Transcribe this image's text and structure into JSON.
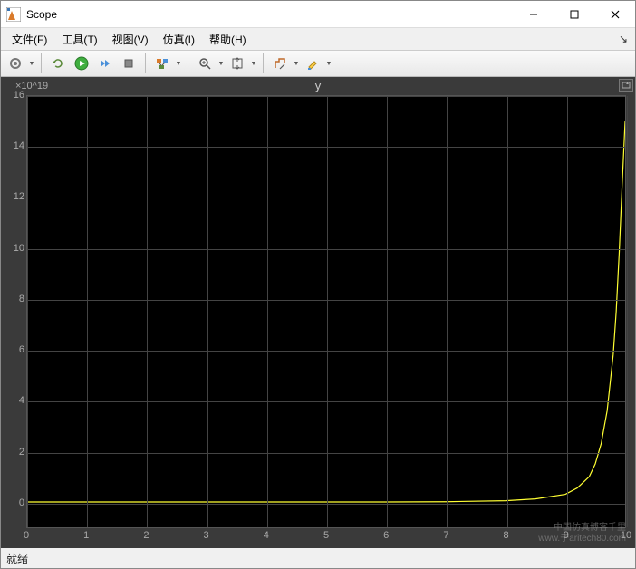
{
  "window": {
    "title": "Scope"
  },
  "menu": {
    "file": "文件(F)",
    "tools": "工具(T)",
    "view": "视图(V)",
    "simulation": "仿真(I)",
    "help": "帮助(H)"
  },
  "status": {
    "text": "就绪"
  },
  "watermark": {
    "line1": "中国仿真博客千里",
    "line2": "www.于aritech80.com"
  },
  "chart_data": {
    "type": "line",
    "title": "y",
    "xlabel": "",
    "ylabel": "",
    "exponent_label": "×10^19",
    "xlim": [
      0,
      10
    ],
    "ylim": [
      -1,
      16
    ],
    "x_ticks": [
      0,
      1,
      2,
      3,
      4,
      5,
      6,
      7,
      8,
      9,
      10
    ],
    "y_ticks": [
      0,
      2,
      4,
      6,
      8,
      10,
      12,
      14,
      16
    ],
    "grid": true,
    "series": [
      {
        "name": "y",
        "color": "#ffff33",
        "x": [
          0,
          1,
          2,
          3,
          4,
          5,
          6,
          7,
          8,
          8.5,
          9,
          9.2,
          9.4,
          9.5,
          9.6,
          9.7,
          9.8,
          9.85,
          9.9,
          9.95,
          10
        ],
        "y_e19": [
          0,
          0,
          0,
          0,
          0,
          0,
          0,
          0.01,
          0.05,
          0.12,
          0.3,
          0.55,
          1.0,
          1.5,
          2.3,
          3.6,
          5.8,
          7.5,
          9.8,
          12.5,
          15
        ]
      }
    ]
  }
}
